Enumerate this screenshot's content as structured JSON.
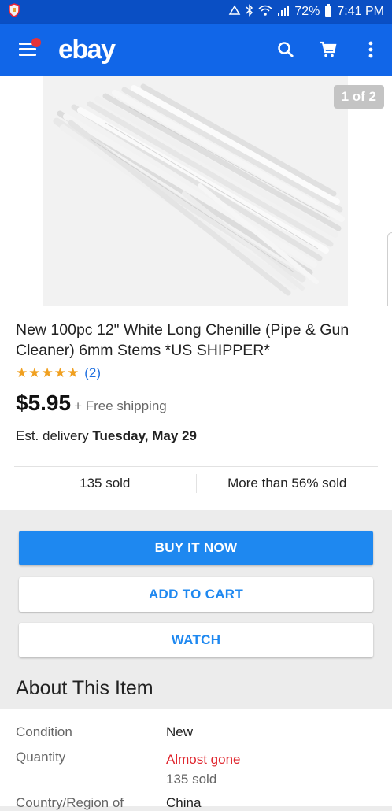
{
  "status_bar": {
    "battery": "72%",
    "time": "7:41 PM"
  },
  "app_bar": {
    "logo": "ebay",
    "icons": [
      "menu-icon",
      "search-icon",
      "cart-icon",
      "more-icon"
    ],
    "accent": "#1166e8"
  },
  "gallery": {
    "counter": "1 of 2"
  },
  "listing": {
    "title": "New 100pc 12\" White Long Chenille (Pipe & Gun Cleaner) 6mm Stems *US SHIPPER*",
    "stars": "★★★★★",
    "rating_value": 5,
    "review_count": "(2)",
    "price": "$5.95",
    "shipping": "+ Free shipping",
    "delivery_prefix": "Est. delivery",
    "delivery_date": "Tuesday, May 29",
    "sold_count": "135 sold",
    "sold_percent": "More than 56% sold"
  },
  "buttons": {
    "buy_now": "BUY IT NOW",
    "add_to_cart": "ADD TO CART",
    "watch": "WATCH"
  },
  "about": {
    "heading": "About This Item",
    "rows": [
      {
        "label": "Condition",
        "value": "New"
      },
      {
        "label": "Quantity",
        "value": "Almost gone",
        "sub": "135 sold"
      },
      {
        "label": "Country/Region of",
        "value": "China"
      }
    ]
  },
  "colors": {
    "status_bar": "#0a4fc4",
    "primary_button": "#1e88f0",
    "star": "#f0a020",
    "alert_red": "#e0262e"
  }
}
